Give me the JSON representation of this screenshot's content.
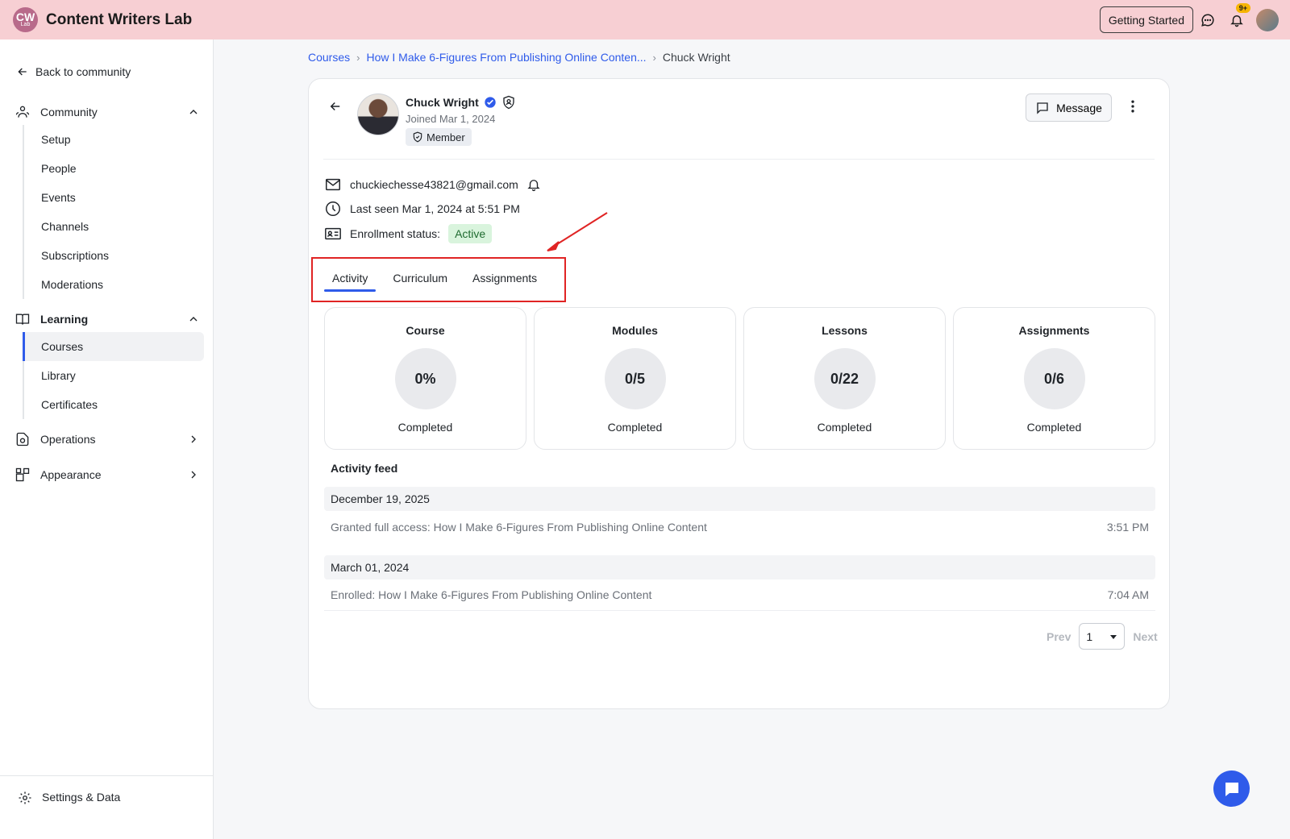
{
  "app": {
    "logo_text": "CW",
    "logo_sub": "Lab",
    "title": "Content Writers Lab",
    "getting_started_label": "Getting Started",
    "notification_badge": "9+"
  },
  "sidebar": {
    "back_label": "Back to community",
    "sections": {
      "community": {
        "label": "Community",
        "items": [
          "Setup",
          "People",
          "Events",
          "Channels",
          "Subscriptions",
          "Moderations"
        ]
      },
      "learning": {
        "label": "Learning",
        "items": [
          "Courses",
          "Library",
          "Certificates"
        ]
      },
      "operations": {
        "label": "Operations"
      },
      "appearance": {
        "label": "Appearance"
      }
    },
    "settings_label": "Settings & Data"
  },
  "breadcrumb": {
    "items": [
      "Courses",
      "How I Make 6-Figures From Publishing Online Conten...",
      "Chuck Wright"
    ]
  },
  "profile": {
    "name": "Chuck Wright",
    "joined": "Joined Mar 1, 2024",
    "role": "Member",
    "message_label": "Message",
    "email": "chuckiechesse43821@gmail.com",
    "last_seen": "Last seen Mar 1, 2024 at 5:51 PM",
    "enrollment_label": "Enrollment status:",
    "enrollment_status": "Active"
  },
  "tabs": [
    "Activity",
    "Curriculum",
    "Assignments"
  ],
  "stats": [
    {
      "title": "Course",
      "value": "0%",
      "sub": "Completed"
    },
    {
      "title": "Modules",
      "value": "0/5",
      "sub": "Completed"
    },
    {
      "title": "Lessons",
      "value": "0/22",
      "sub": "Completed"
    },
    {
      "title": "Assignments",
      "value": "0/6",
      "sub": "Completed"
    }
  ],
  "feed": {
    "title": "Activity feed",
    "groups": [
      {
        "date": "December 19, 2025",
        "text": "Granted full access: How I Make 6-Figures From Publishing Online Content",
        "time": "3:51 PM"
      },
      {
        "date": "March 01, 2024",
        "text": "Enrolled: How I Make 6-Figures From Publishing Online Content",
        "time": "7:04 AM"
      }
    ]
  },
  "pager": {
    "prev": "Prev",
    "page": "1",
    "next": "Next"
  },
  "colors": {
    "accent": "#2f5bea",
    "topbar": "#f7cfd3",
    "highlight": "#e02424",
    "active_status_bg": "#d9f4dd"
  }
}
